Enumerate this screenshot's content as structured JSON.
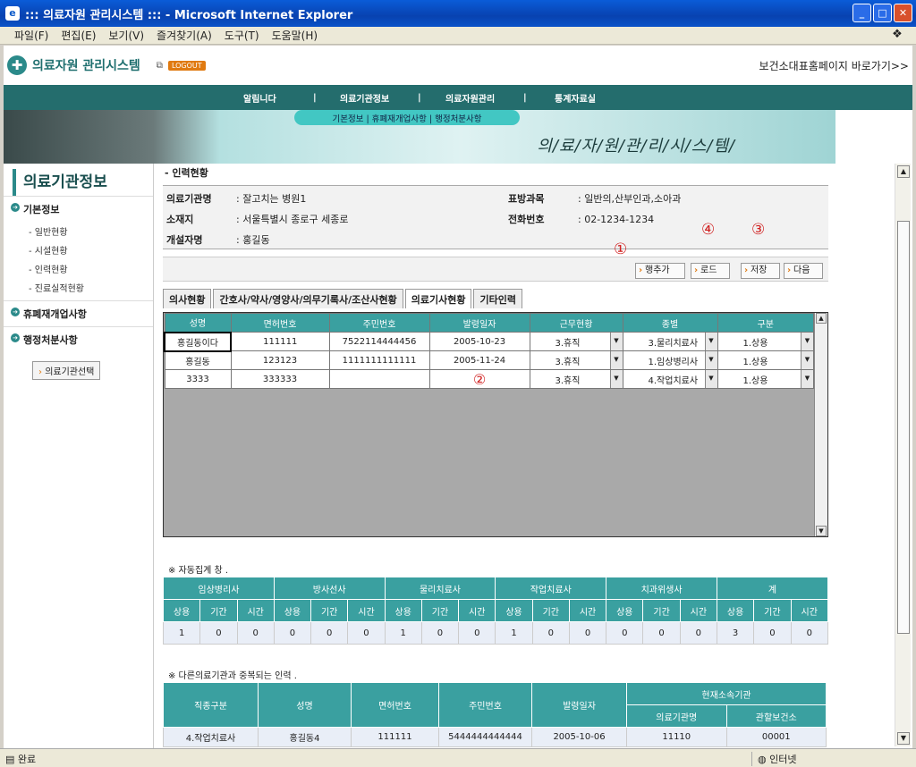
{
  "window": {
    "title": "::: 의료자원 관리시스템 ::: - Microsoft Internet Explorer",
    "min": "_",
    "max": "□",
    "close": "✕"
  },
  "menubar": [
    "파일(F)",
    "편집(E)",
    "보기(V)",
    "즐겨찾기(A)",
    "도구(T)",
    "도움말(H)"
  ],
  "header": {
    "logo": "의료자원 관리시스템",
    "logout": "LOGOUT",
    "home_link": "보건소대표홈페이지 바로가기>>"
  },
  "nav": {
    "items": [
      "알림니다",
      "의료기관정보",
      "의료자원관리",
      "통계자료실"
    ],
    "sep": "|",
    "submenu": "기본정보 | 휴폐재개업사항 | 행정처분사항",
    "banner_text": "의/료/자/원/관/리/시/스/템/"
  },
  "sidebar": {
    "title": "의료기관정보",
    "sections": [
      {
        "label": "기본정보",
        "items": [
          "- 일반현황",
          "- 시설현황",
          "- 인력현황",
          "- 진료실적현황"
        ]
      },
      {
        "label": "휴폐재개업사항",
        "items": []
      },
      {
        "label": "행정처분사항",
        "items": []
      }
    ],
    "select_button": "의료기관선택"
  },
  "page": {
    "section_title": "- 인력현황",
    "info": {
      "name_label": "의료기관명",
      "name": ": 잘고치는 병원1",
      "dept_label": "표방과목",
      "dept": ": 일반의,산부인과,소아과",
      "addr_label": "소재지",
      "addr": ": 서울특별시 종로구 세종로",
      "phone_label": "전화번호",
      "phone": ": 02-1234-1234",
      "founder_label": "개설자명",
      "founder": ": 홍길동"
    },
    "buttons": {
      "add_row": "행추가",
      "load": "로드",
      "save": "저장",
      "next": "다음"
    },
    "markers": {
      "m1": "①",
      "m2": "②",
      "m3": "③",
      "m4": "④"
    },
    "tabs": [
      "의사현황",
      "간호사/약사/영양사/의무기록사/조산사현황",
      "의료기사현황",
      "기타인력"
    ],
    "grid": {
      "headers": [
        "성명",
        "면허번호",
        "주민번호",
        "발령일자",
        "근무현황",
        "종별",
        "구분"
      ],
      "rows": [
        [
          "홍길동이다",
          "111111",
          "7522114444456",
          "2005-10-23",
          "3.휴직",
          "3.물리치료사",
          "1.상용"
        ],
        [
          "홍길동",
          "123123",
          "1111111111111",
          "2005-11-24",
          "3.휴직",
          "1.임상병리사",
          "1.상용"
        ],
        [
          "3333",
          "333333",
          "",
          "",
          "3.휴직",
          "4.작업치료사",
          "1.상용"
        ]
      ]
    },
    "note1": "※ 자동집계 창 .",
    "summary": {
      "groups": [
        "임상병리사",
        "방사선사",
        "물리치료사",
        "작업치료사",
        "치과위생사",
        "계"
      ],
      "sub": [
        "상용",
        "기간",
        "시간"
      ],
      "values": [
        "1",
        "0",
        "0",
        "0",
        "0",
        "0",
        "1",
        "0",
        "0",
        "1",
        "0",
        "0",
        "0",
        "0",
        "0",
        "3",
        "0",
        "0"
      ]
    },
    "note2": "※ 다른의료기관과 중복되는 인력 .",
    "dup": {
      "headers": [
        "직종구분",
        "성명",
        "면허번호",
        "주민번호",
        "발령일자",
        "현재소속기관"
      ],
      "sub": [
        "의료기관명",
        "관할보건소"
      ],
      "rows": [
        [
          "4.작업치료사",
          "홍길동4",
          "111111",
          "5444444444444",
          "2005-10-06",
          "11110",
          "00001"
        ]
      ]
    }
  },
  "status": {
    "left": "완료",
    "right": "인터넷"
  }
}
